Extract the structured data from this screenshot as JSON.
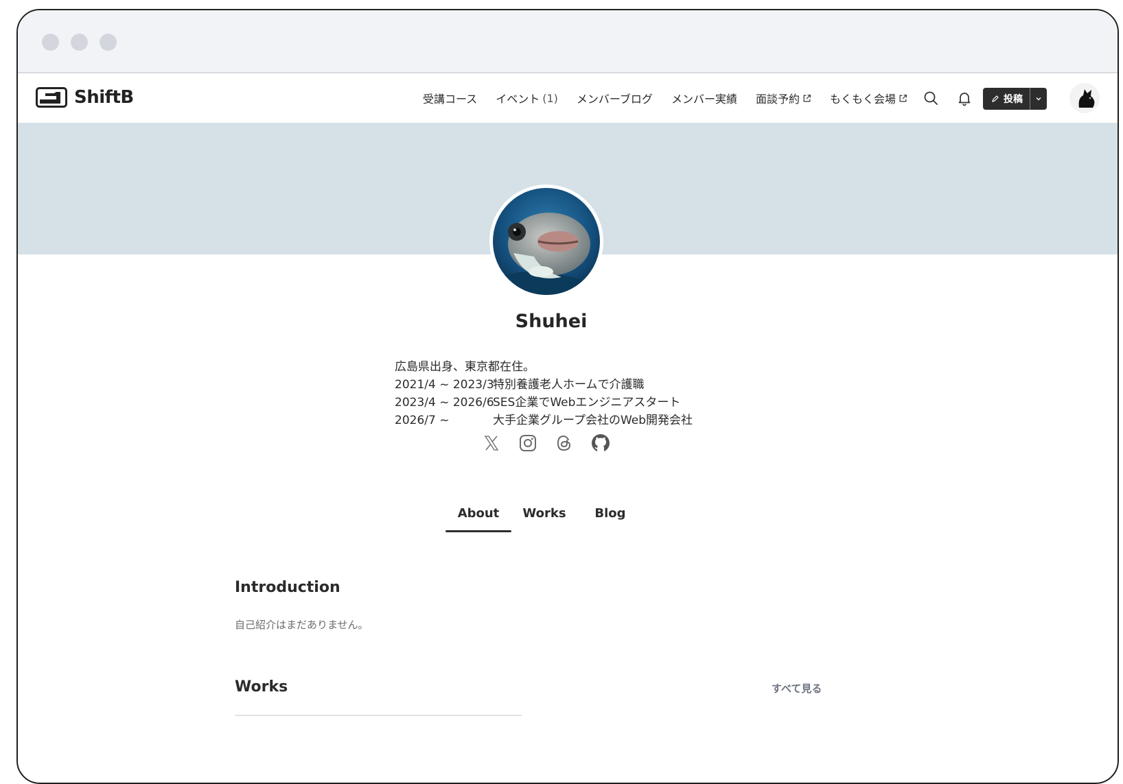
{
  "window": {
    "controls": [
      "close",
      "minimize",
      "maximize"
    ]
  },
  "header": {
    "logo_text": "ShiftB",
    "nav": [
      {
        "label": "受講コース"
      },
      {
        "label": "イベント",
        "count": "(1)"
      },
      {
        "label": "メンバーブログ"
      },
      {
        "label": "メンバー実績"
      },
      {
        "label": "面談予約",
        "external": true
      },
      {
        "label": "もくもく会場",
        "external": true
      }
    ],
    "search_icon": "search-icon",
    "bell_icon": "bell-icon",
    "post_label": "投稿"
  },
  "profile": {
    "name": "Shuhei",
    "bio": [
      {
        "date": "広島県出身、東京都在住。",
        "text": ""
      },
      {
        "date": "2021/4 ~ 2023/3",
        "text": "特別養護老人ホームで介護職"
      },
      {
        "date": "2023/4 ~ 2026/6",
        "text": "SES企業でWebエンジニアスタート"
      },
      {
        "date": "2026/7 ~",
        "text": "大手企業グループ会社のWeb開発会社"
      }
    ],
    "socials": [
      "x-icon",
      "instagram-icon",
      "threads-icon",
      "github-icon"
    ]
  },
  "tabs": [
    {
      "label": "About",
      "active": true
    },
    {
      "label": "Works",
      "active": false
    },
    {
      "label": "Blog",
      "active": false
    }
  ],
  "about": {
    "intro_title": "Introduction",
    "intro_text": "自己紹介はまだありません。",
    "works_title": "Works",
    "see_all": "すべて見る"
  },
  "colors": {
    "banner": "#d5e1e7",
    "button_dark": "#2d2d2d",
    "titlebar": "#f1f3f6"
  }
}
